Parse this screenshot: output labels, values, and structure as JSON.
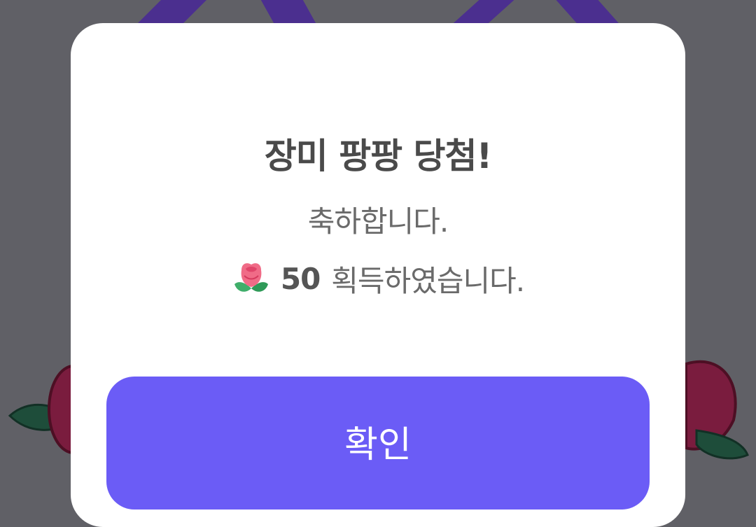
{
  "dialog": {
    "title": "장미 팡팡 당첨!",
    "message_line1": "축하합니다.",
    "reward_amount": "50",
    "reward_suffix": "획득하였습니다.",
    "reward_icon": "rose-icon",
    "confirm_label": "확인"
  },
  "colors": {
    "overlay": "#606066",
    "dialog_bg": "#ffffff",
    "title_text": "#4a4a4a",
    "body_text": "#6a6a6a",
    "button_bg": "#6b5cf6",
    "button_text": "#ffffff"
  }
}
